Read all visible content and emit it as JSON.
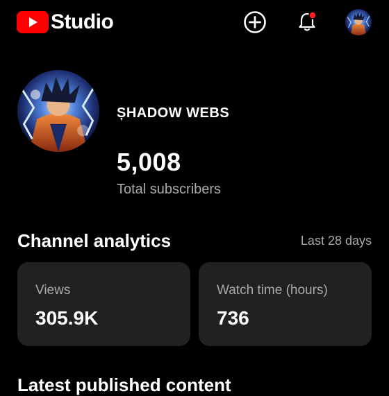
{
  "app": {
    "logo_text": "Studio",
    "brand_color": "#ff0000"
  },
  "header": {
    "icons": [
      "create-icon",
      "notifications-icon",
      "account-avatar"
    ],
    "notification_dot_color": "#ff0000"
  },
  "channel": {
    "name": "ȘHADOW WEBS",
    "subscribers": "5,008",
    "subscribers_label": "Total subscribers"
  },
  "analytics": {
    "title": "Channel analytics",
    "period": "Last 28 days",
    "cards": [
      {
        "label": "Views",
        "value": "305.9K"
      },
      {
        "label": "Watch time (hours)",
        "value": "736"
      }
    ]
  },
  "next_section": {
    "title": "Latest published content"
  }
}
